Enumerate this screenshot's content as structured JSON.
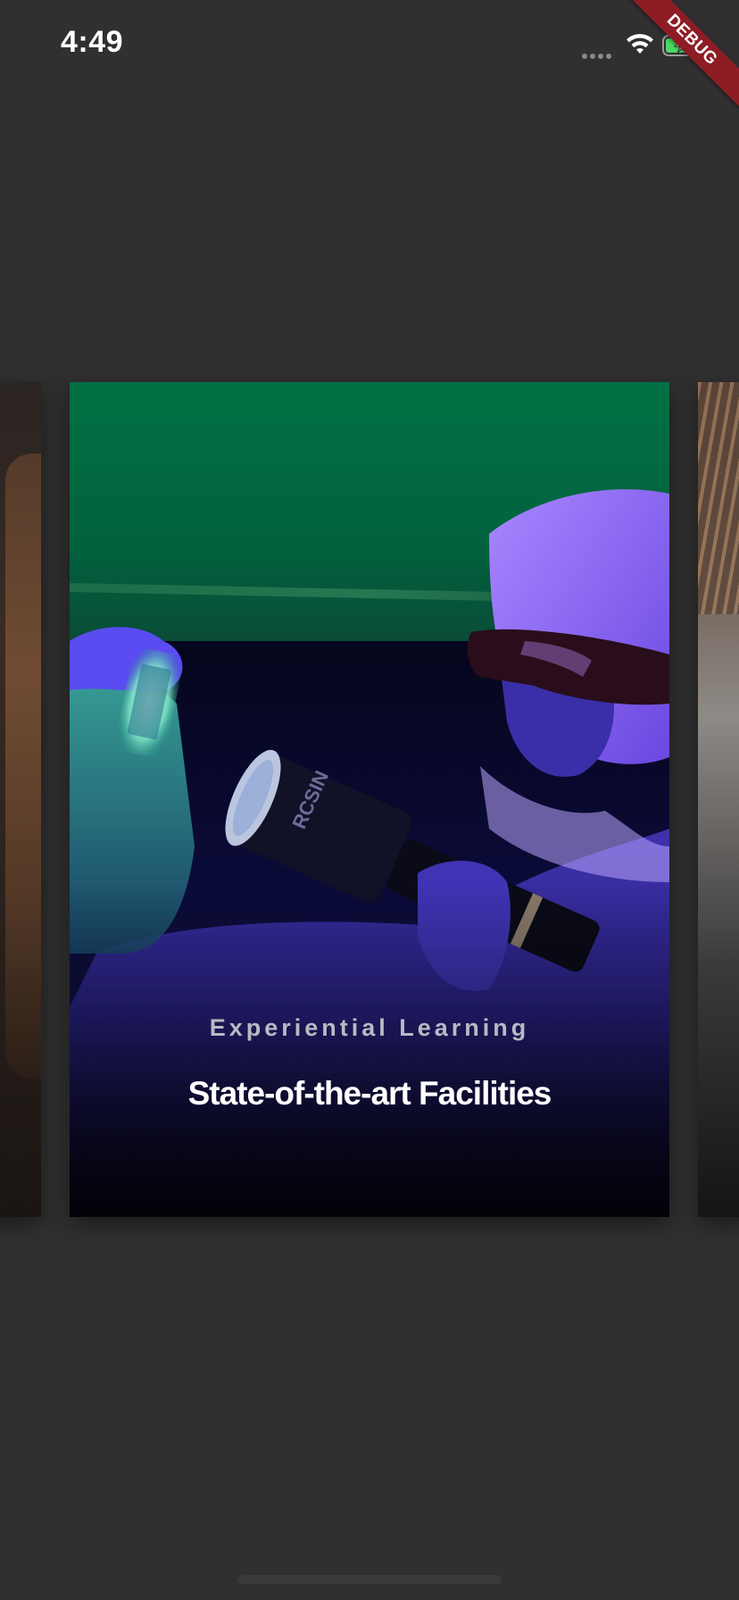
{
  "status_bar": {
    "time": "4:49",
    "icons": [
      "signal-icon",
      "wifi-icon",
      "battery-charging-icon"
    ]
  },
  "debug_banner": {
    "label": "DEBUG",
    "color": "#8e1c25"
  },
  "carousel": {
    "cards": [
      {
        "position": "previous",
        "image": "person-with-long-hair-photo"
      },
      {
        "position": "current",
        "subtitle": "Experiential Learning",
        "title": "State-of-the-art Facilities",
        "image": "researcher-with-uv-flashlight-photo"
      },
      {
        "position": "next",
        "image": "building-interior-photo"
      }
    ]
  },
  "colors": {
    "background": "#303030",
    "card_green": "#017043",
    "title_text": "#ffffff",
    "subtitle_text": "#b9b9c3"
  }
}
